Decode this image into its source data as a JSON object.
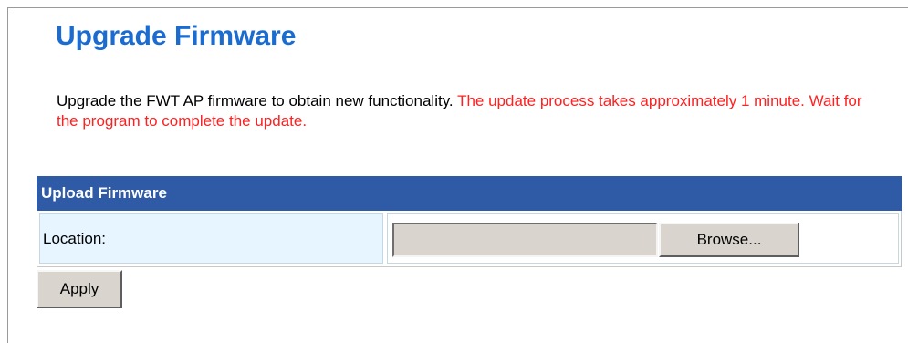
{
  "page": {
    "title": "Upgrade Firmware",
    "description_normal": "Upgrade the FWT AP firmware to obtain new functionality. ",
    "description_warning": "The update process takes approximately 1 minute. Wait for the program to complete the update."
  },
  "upload": {
    "section_title": "Upload Firmware",
    "location_label": "Location:",
    "location_value": "",
    "browse_label": "Browse..."
  },
  "actions": {
    "apply_label": "Apply"
  },
  "colors": {
    "title": "#1a6cd0",
    "warning_text": "#ff2020",
    "section_header_bg": "#2e5aa6",
    "label_cell_bg": "#e6f5ff",
    "button_bg": "#d9d5ce"
  }
}
